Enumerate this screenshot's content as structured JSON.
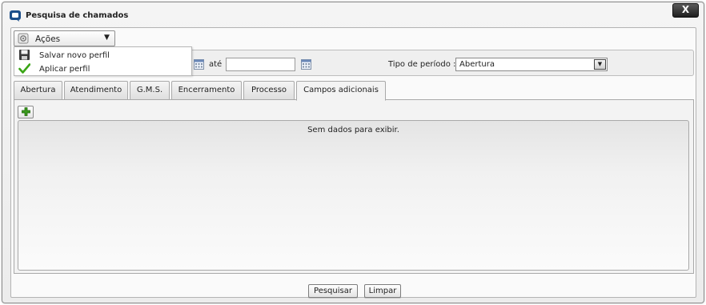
{
  "window": {
    "title": "Pesquisa de chamados",
    "close_label": "X"
  },
  "actions": {
    "label": "Ações",
    "menu": [
      {
        "label": "Salvar novo perfil",
        "icon": "floppy-disk-icon"
      },
      {
        "label": "Aplicar perfil",
        "icon": "checkmark-icon"
      }
    ]
  },
  "filter": {
    "ate_label": "até",
    "date_value": "",
    "tipo_label": "Tipo de período :",
    "tipo_value": "Abertura"
  },
  "tabs": [
    {
      "label": "Abertura"
    },
    {
      "label": "Atendimento"
    },
    {
      "label": "G.M.S."
    },
    {
      "label": "Encerramento"
    },
    {
      "label": "Processo"
    },
    {
      "label": "Campos adicionais",
      "active": true
    }
  ],
  "grid": {
    "empty_message": "Sem dados para exibir."
  },
  "footer": {
    "search_label": "Pesquisar",
    "clear_label": "Limpar"
  },
  "colors": {
    "add_green": "#3a9a1c",
    "check_green": "#3aa516",
    "app_icon_blue": "#1d4f8a"
  }
}
